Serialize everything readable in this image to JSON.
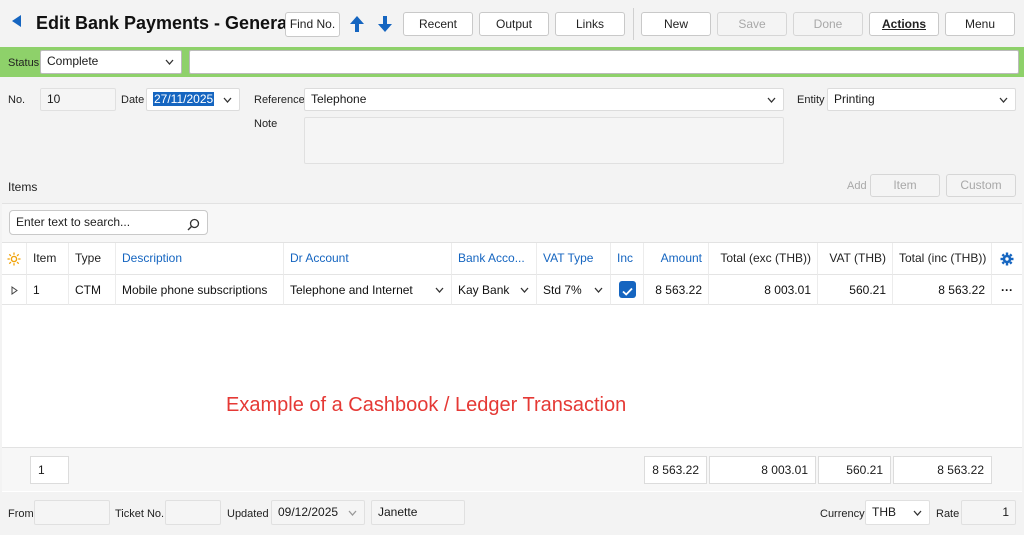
{
  "header": {
    "title": "Edit Bank Payments - General",
    "find_label": "Find No.",
    "buttons": {
      "recent": "Recent",
      "output": "Output",
      "links": "Links",
      "new": "New",
      "save": "Save",
      "done": "Done",
      "actions": "Actions",
      "menu": "Menu"
    }
  },
  "status": {
    "label": "Status",
    "value": "Complete",
    "note_value": ""
  },
  "form": {
    "no_label": "No.",
    "no_value": "10",
    "date_label": "Date",
    "date_value": "27/11/2025",
    "reference_label": "Reference",
    "reference_value": "Telephone",
    "entity_label": "Entity",
    "entity_value": "Printing",
    "note_label": "Note",
    "note_value": ""
  },
  "items": {
    "label": "Items",
    "add_label": "Add",
    "item_button": "Item",
    "custom_button": "Custom",
    "search_placeholder": "Enter text to search...",
    "columns": [
      "Item",
      "Type",
      "Description",
      "Dr Account",
      "Bank  Acco...",
      "VAT Type",
      "Inc",
      "Amount",
      "Total (exc (THB))",
      "VAT (THB)",
      "Total (inc (THB))"
    ],
    "rows": [
      {
        "item": "1",
        "type": "CTM",
        "description": "Mobile phone subscriptions",
        "dr_account": "Telephone and Internet",
        "bank_account": "Kay Bank",
        "vat_type": "Std 7%",
        "inc": true,
        "amount": "8 563.22",
        "total_exc": "8 003.01",
        "vat": "560.21",
        "total_inc": "8 563.22",
        "more": "···"
      }
    ],
    "totals": {
      "count": "1",
      "amount": "8 563.22",
      "total_exc": "8 003.01",
      "vat": "560.21",
      "total_inc": "8 563.22"
    }
  },
  "annotation": {
    "text": "Example of a Cashbook / Ledger Transaction",
    "color": "#e53935"
  },
  "footer": {
    "from_label": "From",
    "from_value": "",
    "ticket_label": "Ticket No.",
    "ticket_value": "",
    "updated_label": "Updated",
    "updated_value": "09/12/2025",
    "updated_by": "Janette",
    "currency_label": "Currency",
    "currency_value": "THB",
    "rate_label": "Rate",
    "rate_value": "1"
  },
  "colors": {
    "accent": "#1565c0",
    "status_bar": "#8ed16a",
    "checkbox": "#1565c0"
  }
}
